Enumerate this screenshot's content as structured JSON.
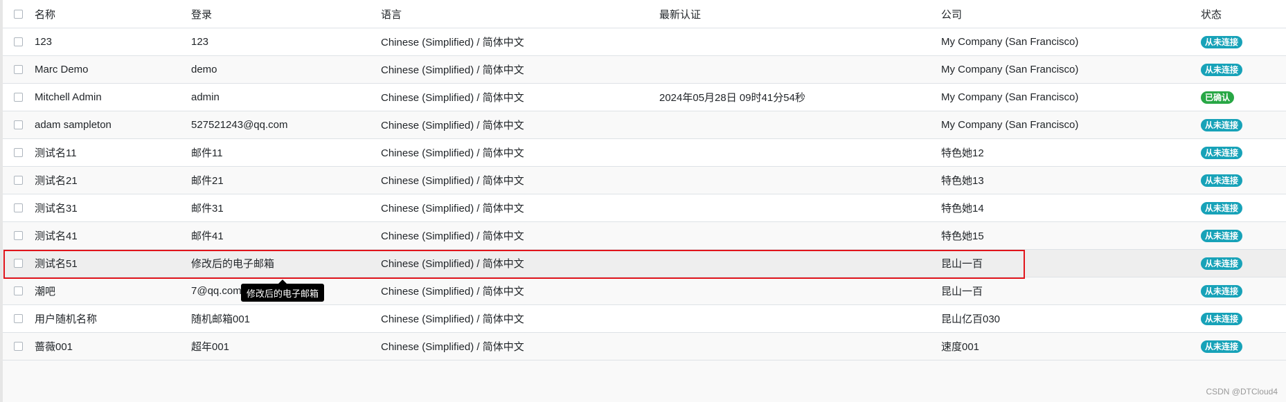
{
  "table": {
    "headers": {
      "name": "名称",
      "login": "登录",
      "language": "语言",
      "last_auth": "最新认证",
      "company": "公司",
      "status": "状态"
    },
    "rows": [
      {
        "name": "123",
        "login": "123",
        "language": "Chinese (Simplified) / 简体中文",
        "last_auth": "",
        "company": "My Company (San Francisco)",
        "status": "从未连接",
        "status_type": "info"
      },
      {
        "name": "Marc Demo",
        "login": "demo",
        "language": "Chinese (Simplified) / 简体中文",
        "last_auth": "",
        "company": "My Company (San Francisco)",
        "status": "从未连接",
        "status_type": "info"
      },
      {
        "name": "Mitchell Admin",
        "login": "admin",
        "language": "Chinese (Simplified) / 简体中文",
        "last_auth": "2024年05月28日 09时41分54秒",
        "company": "My Company (San Francisco)",
        "status": "已确认",
        "status_type": "success"
      },
      {
        "name": "adam sampleton",
        "login": "527521243@qq.com",
        "language": "Chinese (Simplified) / 简体中文",
        "last_auth": "",
        "company": "My Company (San Francisco)",
        "status": "从未连接",
        "status_type": "info"
      },
      {
        "name": "测试名11",
        "login": "邮件11",
        "language": "Chinese (Simplified) / 简体中文",
        "last_auth": "",
        "company": "特色她12",
        "status": "从未连接",
        "status_type": "info"
      },
      {
        "name": "测试名21",
        "login": "邮件21",
        "language": "Chinese (Simplified) / 简体中文",
        "last_auth": "",
        "company": "特色她13",
        "status": "从未连接",
        "status_type": "info"
      },
      {
        "name": "测试名31",
        "login": "邮件31",
        "language": "Chinese (Simplified) / 简体中文",
        "last_auth": "",
        "company": "特色她14",
        "status": "从未连接",
        "status_type": "info"
      },
      {
        "name": "测试名41",
        "login": "邮件41",
        "language": "Chinese (Simplified) / 简体中文",
        "last_auth": "",
        "company": "特色她15",
        "status": "从未连接",
        "status_type": "info"
      },
      {
        "name": "测试名51",
        "login": "修改后的电子邮箱",
        "language": "Chinese (Simplified) / 简体中文",
        "last_auth": "",
        "company": "昆山一百",
        "status": "从未连接",
        "status_type": "info"
      },
      {
        "name": "潮吧",
        "login": "7@qq.com",
        "language": "Chinese (Simplified) / 简体中文",
        "last_auth": "",
        "company": "昆山一百",
        "status": "从未连接",
        "status_type": "info"
      },
      {
        "name": "用户随机名称",
        "login": "随机邮箱001",
        "language": "Chinese (Simplified) / 简体中文",
        "last_auth": "",
        "company": "昆山亿百030",
        "status": "从未连接",
        "status_type": "info"
      },
      {
        "name": "蔷薇001",
        "login": "超年001",
        "language": "Chinese (Simplified) / 简体中文",
        "last_auth": "",
        "company": "速度001",
        "status": "从未连接",
        "status_type": "info"
      }
    ]
  },
  "tooltip": {
    "text": "修改后的电子邮箱"
  },
  "watermark": "CSDN @DTCloud4",
  "colors": {
    "badge_info": "#17a2b8",
    "badge_success": "#28a745",
    "highlight": "#e1141b"
  }
}
